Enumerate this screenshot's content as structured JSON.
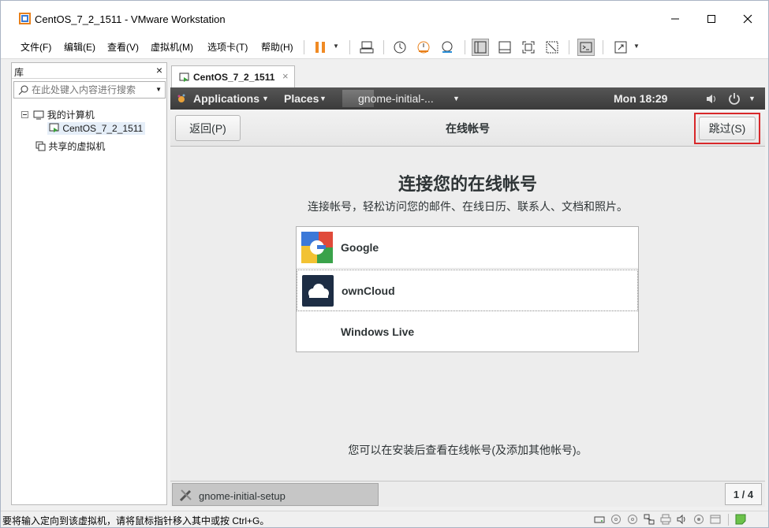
{
  "window": {
    "title": "CentOS_7_2_1511 - VMware Workstation"
  },
  "menubar": {
    "items": [
      "文件(F)",
      "编辑(E)",
      "查看(V)",
      "虚拟机(M)",
      "选项卡(T)",
      "帮助(H)"
    ]
  },
  "library": {
    "title": "库",
    "search_placeholder": "在此处键入内容进行搜索",
    "tree": {
      "my_computer": "我的计算机",
      "vm": "CentOS_7_2_1511",
      "shared": "共享的虚拟机"
    }
  },
  "vm_tab": {
    "label": "CentOS_7_2_1511"
  },
  "gnome": {
    "applications": "Applications",
    "places": "Places",
    "window_menu": "gnome-initial-...",
    "clock": "Mon 18:29",
    "back_label": "返回(P)",
    "header_title": "在线帐号",
    "skip_label": "跳过(S)",
    "heading": "连接您的在线帐号",
    "subheading": "连接帐号，轻松访问您的邮件、在线日历、联系人、文档和照片。",
    "providers": [
      "Google",
      "ownCloud",
      "Windows Live"
    ],
    "footer_note": "您可以在安装后查看在线帐号(及添加其他帐号)。",
    "task_label": "gnome-initial-setup",
    "page_count": "1 / 4"
  },
  "statusbar": {
    "text": "要将输入定向到该虚拟机，请将鼠标指针移入其中或按 Ctrl+G。"
  },
  "colors": {
    "highlight_border": "#d8282a",
    "vmware_orange": "#e8801a",
    "pause_orange": "#f08a24"
  }
}
